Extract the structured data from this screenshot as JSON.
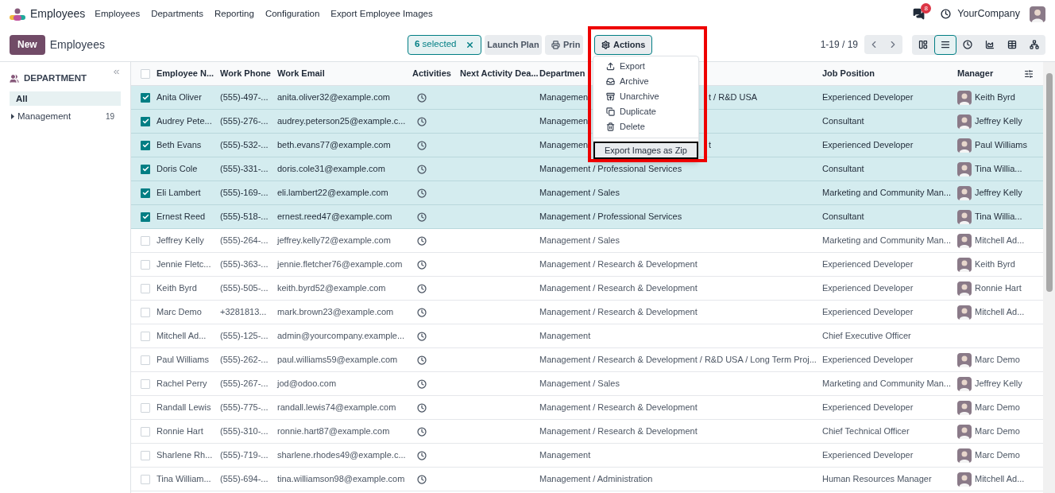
{
  "app": {
    "name": "Employees"
  },
  "menu": [
    "Employees",
    "Departments",
    "Reporting",
    "Configuration",
    "Export Employee Images"
  ],
  "systray": {
    "message_count": "8",
    "company": "YourCompany"
  },
  "control": {
    "new_button": "New",
    "title": "Employees",
    "selection": "6 selected",
    "launch_plan_button": "Launch Plan",
    "print_button": "Prin",
    "actions_button": "Actions",
    "pager": "1-19 / 19"
  },
  "views": [
    {
      "kind": "kanban",
      "selected": false
    },
    {
      "kind": "list",
      "selected": true
    },
    {
      "kind": "activity",
      "selected": false
    },
    {
      "kind": "graph",
      "selected": false
    },
    {
      "kind": "pivot",
      "selected": false
    },
    {
      "kind": "hierarchy",
      "selected": false
    }
  ],
  "sidebar": {
    "title": "DEPARTMENT",
    "items": [
      {
        "label": "All",
        "selected": true
      },
      {
        "label": "Management",
        "count": "19",
        "selected": false
      }
    ]
  },
  "table": {
    "all_selected": false,
    "columns": [
      "Employee N...",
      "Work Phone",
      "Work Email",
      "Activities",
      "Next Activity Dea...",
      "Departmen",
      "Job Position",
      "Manager"
    ],
    "rows": [
      {
        "checked": true,
        "name": "Anita Oliver",
        "phone": "(555)-497-...",
        "email": "anita.oliver32@example.com",
        "department": "Managemen",
        "department_tail": "t / R&D USA",
        "job": "Experienced Developer",
        "manager": "Keith Byrd"
      },
      {
        "checked": true,
        "name": "Audrey Pete...",
        "phone": "(555)-276-...",
        "email": "audrey.peterson25@example.c...",
        "department": "Managemen",
        "job": "Consultant",
        "manager": "Jeffrey Kelly"
      },
      {
        "checked": true,
        "name": "Beth Evans",
        "phone": "(555)-532-...",
        "email": "beth.evans77@example.com",
        "department": "Managemen",
        "department_tail": "t",
        "job": "Experienced Developer",
        "manager": "Paul Williams"
      },
      {
        "checked": true,
        "name": "Doris Cole",
        "phone": "(555)-331-...",
        "email": "doris.cole31@example.com",
        "department": "Management / Professional Services",
        "job": "Consultant",
        "manager": "Tina Willia..."
      },
      {
        "checked": true,
        "name": "Eli Lambert",
        "phone": "(555)-169-...",
        "email": "eli.lambert22@example.com",
        "department": "Management / Sales",
        "job": "Marketing and Community Man...",
        "manager": "Jeffrey Kelly"
      },
      {
        "checked": true,
        "name": "Ernest Reed",
        "phone": "(555)-518-...",
        "email": "ernest.reed47@example.com",
        "department": "Management / Professional Services",
        "job": "Consultant",
        "manager": "Tina Willia..."
      },
      {
        "checked": false,
        "name": "Jeffrey Kelly",
        "phone": "(555)-264-...",
        "email": "jeffrey.kelly72@example.com",
        "department": "Management / Sales",
        "job": "Marketing and Community Man...",
        "manager": "Mitchell Ad..."
      },
      {
        "checked": false,
        "name": "Jennie Fletc...",
        "phone": "(555)-363-...",
        "email": "jennie.fletcher76@example.com",
        "department": "Management / Research & Development",
        "job": "Experienced Developer",
        "manager": "Keith Byrd"
      },
      {
        "checked": false,
        "name": "Keith Byrd",
        "phone": "(555)-505-...",
        "email": "keith.byrd52@example.com",
        "department": "Management / Research & Development",
        "job": "Experienced Developer",
        "manager": "Ronnie Hart"
      },
      {
        "checked": false,
        "name": "Marc Demo",
        "phone": "+3281813...",
        "email": "mark.brown23@example.com",
        "department": "Management / Research & Development",
        "job": "Experienced Developer",
        "manager": "Mitchell Ad..."
      },
      {
        "checked": false,
        "name": "Mitchell Ad...",
        "phone": "(555)-125-...",
        "email": "admin@yourcompany.example...",
        "department": "Management",
        "job": "Chief Executive Officer"
      },
      {
        "checked": false,
        "name": "Paul Williams",
        "phone": "(555)-262-...",
        "email": "paul.williams59@example.com",
        "department": "Management / Research & Development / R&D USA / Long Term Proj...",
        "job": "Experienced Developer",
        "manager": "Marc Demo"
      },
      {
        "checked": false,
        "name": "Rachel Perry",
        "phone": "(555)-267-...",
        "email": "jod@odoo.com",
        "department": "Management / Sales",
        "job": "Marketing and Community Man...",
        "manager": "Jeffrey Kelly"
      },
      {
        "checked": false,
        "name": "Randall Lewis",
        "phone": "(555)-775-...",
        "email": "randall.lewis74@example.com",
        "department": "Management / Research & Development",
        "job": "Experienced Developer",
        "manager": "Marc Demo"
      },
      {
        "checked": false,
        "name": "Ronnie Hart",
        "phone": "(555)-310-...",
        "email": "ronnie.hart87@example.com",
        "department": "Management / Research & Development",
        "job": "Chief Technical Officer",
        "manager": "Marc Demo"
      },
      {
        "checked": false,
        "name": "Sharlene Rh...",
        "phone": "(555)-719-...",
        "email": "sharlene.rhodes49@example.c...",
        "department": "Management",
        "job": "Experienced Developer",
        "manager": "Marc Demo"
      },
      {
        "checked": false,
        "name": "Tina William...",
        "phone": "(555)-694-...",
        "email": "tina.williamson98@example.com",
        "department": "Management / Administration",
        "job": "Human Resources Manager",
        "manager": "Mitchell Ad..."
      }
    ]
  },
  "actions_menu": {
    "items": [
      {
        "label": "Export",
        "kind": "export"
      },
      {
        "label": "Archive",
        "kind": "archive"
      },
      {
        "label": "Unarchive",
        "kind": "unarchive"
      },
      {
        "label": "Duplicate",
        "kind": "duplicate"
      },
      {
        "label": "Delete",
        "kind": "delete"
      }
    ],
    "extra_items": [
      {
        "label": "Export Images as Zip",
        "selected": true
      }
    ]
  }
}
